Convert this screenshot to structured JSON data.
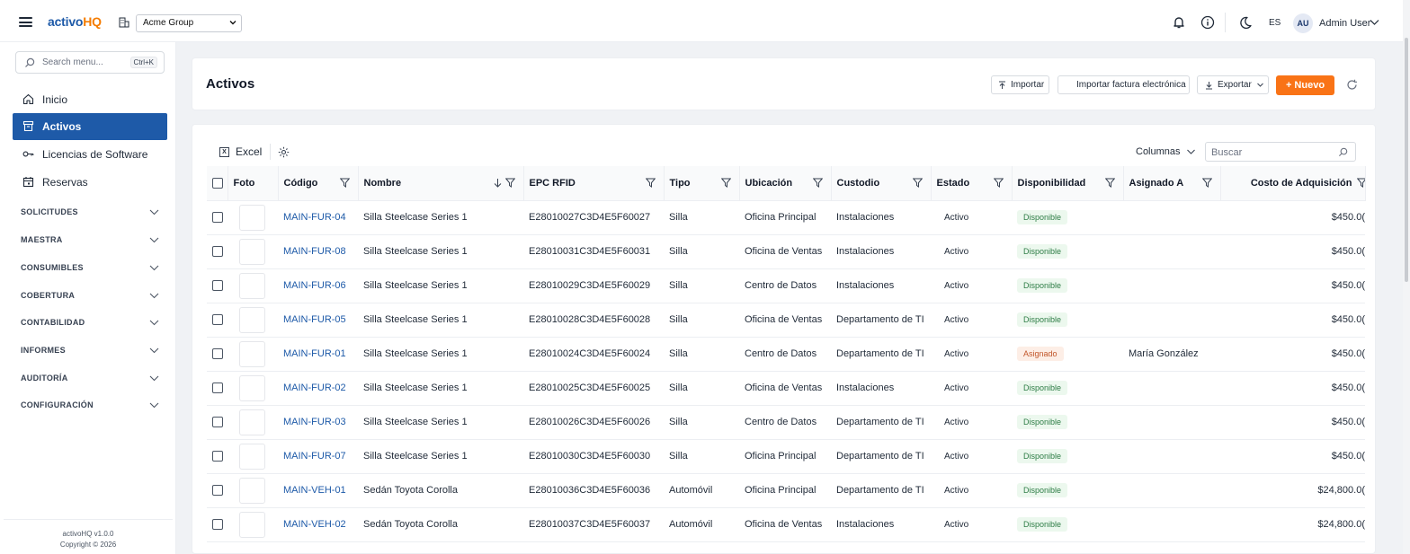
{
  "header": {
    "logo_part1": "activo",
    "logo_part2": "HQ",
    "org_selected": "Acme Group",
    "lang": "ES",
    "avatar_initials": "AU",
    "user_name": "Admin User"
  },
  "sidebar": {
    "search_placeholder": "Search menu...",
    "search_shortcut": "Ctrl+K",
    "items": [
      {
        "label": "Inicio",
        "icon": "home-icon"
      },
      {
        "label": "Activos",
        "icon": "archive-icon",
        "active": true
      },
      {
        "label": "Licencias de Software",
        "icon": "key-icon"
      },
      {
        "label": "Reservas",
        "icon": "calendar-icon"
      }
    ],
    "groups": [
      {
        "label": "SOLICITUDES"
      },
      {
        "label": "MAESTRA"
      },
      {
        "label": "CONSUMIBLES"
      },
      {
        "label": "COBERTURA"
      },
      {
        "label": "CONTABILIDAD"
      },
      {
        "label": "INFORMES"
      },
      {
        "label": "AUDITORÍA"
      },
      {
        "label": "CONFIGURACIÓN"
      }
    ],
    "footer_version": "activoHQ v1.0.0",
    "footer_copyright": "Copyright © 2026"
  },
  "page": {
    "title": "Activos",
    "import_label": "Importar",
    "import_invoice_label": "Importar factura electrónica",
    "export_label": "Exportar",
    "new_label": "+ Nuevo"
  },
  "table": {
    "excel_label": "Excel",
    "columns_label": "Columnas",
    "search_placeholder": "Buscar",
    "headers": [
      "Foto",
      "Código",
      "Nombre",
      "EPC RFID",
      "Tipo",
      "Ubicación",
      "Custodio",
      "Estado",
      "Disponibilidad",
      "Asignado A",
      "Costo de Adquisición"
    ],
    "rows": [
      {
        "code": "MAIN-FUR-04",
        "name": "Silla Steelcase Series 1",
        "epc": "E28010027C3D4E5F60027",
        "type": "Silla",
        "location": "Oficina Principal",
        "custodian": "Instalaciones",
        "status": "Activo",
        "availability": "Disponible",
        "assigned": "",
        "cost": "$450.0("
      },
      {
        "code": "MAIN-FUR-08",
        "name": "Silla Steelcase Series 1",
        "epc": "E28010031C3D4E5F60031",
        "type": "Silla",
        "location": "Oficina de Ventas",
        "custodian": "Instalaciones",
        "status": "Activo",
        "availability": "Disponible",
        "assigned": "",
        "cost": "$450.0("
      },
      {
        "code": "MAIN-FUR-06",
        "name": "Silla Steelcase Series 1",
        "epc": "E28010029C3D4E5F60029",
        "type": "Silla",
        "location": "Centro de Datos",
        "custodian": "Instalaciones",
        "status": "Activo",
        "availability": "Disponible",
        "assigned": "",
        "cost": "$450.0("
      },
      {
        "code": "MAIN-FUR-05",
        "name": "Silla Steelcase Series 1",
        "epc": "E28010028C3D4E5F60028",
        "type": "Silla",
        "location": "Oficina de Ventas",
        "custodian": "Departamento de TI",
        "status": "Activo",
        "availability": "Disponible",
        "assigned": "",
        "cost": "$450.0("
      },
      {
        "code": "MAIN-FUR-01",
        "name": "Silla Steelcase Series 1",
        "epc": "E28010024C3D4E5F60024",
        "type": "Silla",
        "location": "Centro de Datos",
        "custodian": "Departamento de TI",
        "status": "Activo",
        "availability": "Asignado",
        "assigned": "María González",
        "cost": "$450.0("
      },
      {
        "code": "MAIN-FUR-02",
        "name": "Silla Steelcase Series 1",
        "epc": "E28010025C3D4E5F60025",
        "type": "Silla",
        "location": "Oficina de Ventas",
        "custodian": "Instalaciones",
        "status": "Activo",
        "availability": "Disponible",
        "assigned": "",
        "cost": "$450.0("
      },
      {
        "code": "MAIN-FUR-03",
        "name": "Silla Steelcase Series 1",
        "epc": "E28010026C3D4E5F60026",
        "type": "Silla",
        "location": "Centro de Datos",
        "custodian": "Departamento de TI",
        "status": "Activo",
        "availability": "Disponible",
        "assigned": "",
        "cost": "$450.0("
      },
      {
        "code": "MAIN-FUR-07",
        "name": "Silla Steelcase Series 1",
        "epc": "E28010030C3D4E5F60030",
        "type": "Silla",
        "location": "Oficina Principal",
        "custodian": "Departamento de TI",
        "status": "Activo",
        "availability": "Disponible",
        "assigned": "",
        "cost": "$450.0("
      },
      {
        "code": "MAIN-VEH-01",
        "name": "Sedán Toyota Corolla",
        "epc": "E28010036C3D4E5F60036",
        "type": "Automóvil",
        "location": "Oficina Principal",
        "custodian": "Departamento de TI",
        "status": "Activo",
        "availability": "Disponible",
        "assigned": "",
        "cost": "$24,800.0("
      },
      {
        "code": "MAIN-VEH-02",
        "name": "Sedán Toyota Corolla",
        "epc": "E28010037C3D4E5F60037",
        "type": "Automóvil",
        "location": "Oficina de Ventas",
        "custodian": "Instalaciones",
        "status": "Activo",
        "availability": "Disponible",
        "assigned": "",
        "cost": "$24,800.0("
      }
    ]
  },
  "colors": {
    "primary": "#1e5aa8",
    "accent": "#f97316",
    "available_bg": "#ecf8ee",
    "available_fg": "#2e7d46",
    "assigned_bg": "#fdeee6",
    "assigned_fg": "#c2562a"
  }
}
